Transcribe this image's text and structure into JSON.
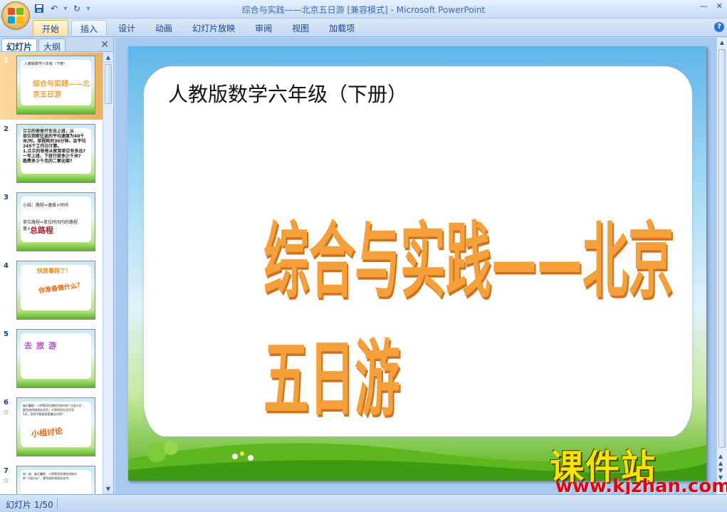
{
  "window": {
    "title": "综合与实践——北京五日游 [兼容模式] - Microsoft PowerPoint",
    "minimize": "—",
    "close": "✕"
  },
  "ribbon": {
    "tabs": [
      "开始",
      "插入",
      "设计",
      "动画",
      "幻灯片放映",
      "审阅",
      "视图",
      "加载项"
    ],
    "active_tab": "开始",
    "help": "?"
  },
  "left_pane": {
    "tabs": [
      "幻灯片",
      "大纲"
    ],
    "close": "✕",
    "thumbnails": [
      {
        "num": "1",
        "lines": [
          "人教版数学六年级（下册）"
        ],
        "big": "综合与实践——北京五日游"
      },
      {
        "num": "2",
        "lines": [
          "兰兰的爸爸开车去上班，从",
          "单位到家往返的平均速度为40千",
          "米/时。单程耗时30分钟。会平均",
          "245个工作日计算。",
          "1.兰兰的爸爸从家到单位有多远?",
          "一年上班、下班行驶多少千米?",
          "路费多少千克的二氧化碳?"
        ]
      },
      {
        "num": "3",
        "lines": [
          "小结：路程=速度×时间",
          "",
          "单位路程=单位时间内的路程",
          "量×"
        ],
        "big": "总路程"
      },
      {
        "num": "4",
        "lines": [
          "快放暑假了！"
        ],
        "big": "你准备做什么？"
      },
      {
        "num": "5",
        "big": "去旅游"
      },
      {
        "num": "6",
        "mark": "☆",
        "lines": [
          "临近暑假，小明等同学想给学校内的“小组讨论”，",
          "要完成的旅游去北京，计划研究在北京呆",
          "5天，怎样才能旅游是最佳计划?"
        ],
        "big": "小组讨论"
      },
      {
        "num": "7",
        "mark": "☆",
        "lines": [
          "说一说：临近暑假，小明等同学想给学校内",
          "的“小组讨论”，要完成的旅游去北京..."
        ]
      }
    ]
  },
  "slide": {
    "subtitle": "人教版数学六年级（下册）",
    "title": "综合与实践——北京五日游"
  },
  "watermark": {
    "title": "课件站",
    "url": "www.kjzhan.com"
  },
  "status": {
    "slide_info": "幻灯片 1/50"
  },
  "colors": {
    "title_orange": "#f6a03b",
    "watermark_yellow": "#f6e400",
    "watermark_red": "#e4000f"
  }
}
